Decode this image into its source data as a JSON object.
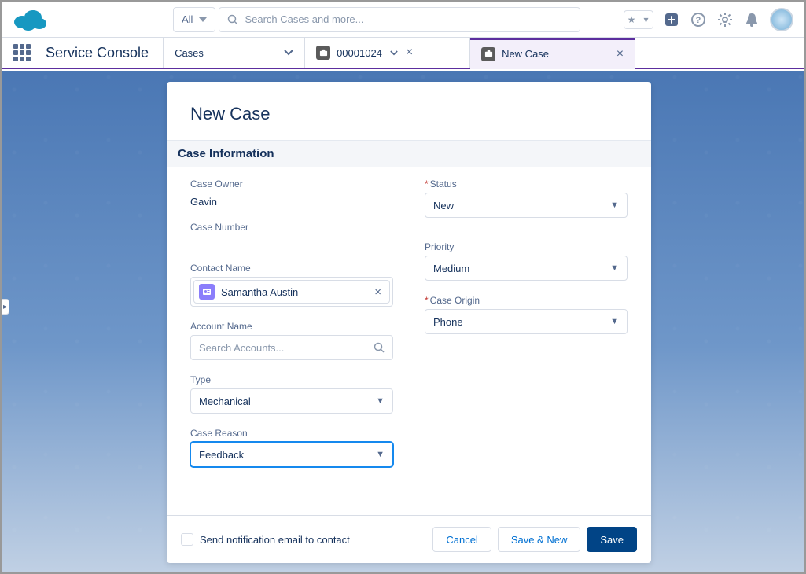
{
  "header": {
    "scope": "All",
    "search_placeholder": "Search Cases and more..."
  },
  "nav": {
    "app_name": "Service Console",
    "tabs": [
      {
        "label": "Cases"
      },
      {
        "label": "00001024"
      },
      {
        "label": "New Case"
      }
    ]
  },
  "modal": {
    "title": "New Case",
    "section": "Case Information",
    "left": {
      "case_owner_label": "Case Owner",
      "case_owner_value": "Gavin",
      "case_number_label": "Case Number",
      "case_number_value": "",
      "contact_name_label": "Contact Name",
      "contact_name_value": "Samantha Austin",
      "account_name_label": "Account Name",
      "account_search_placeholder": "Search Accounts...",
      "type_label": "Type",
      "type_value": "Mechanical",
      "case_reason_label": "Case Reason",
      "case_reason_value": "Feedback"
    },
    "right": {
      "status_label": "Status",
      "status_value": "New",
      "priority_label": "Priority",
      "priority_value": "Medium",
      "case_origin_label": "Case Origin",
      "case_origin_value": "Phone"
    },
    "footer": {
      "notify_label": "Send notification email to contact",
      "cancel": "Cancel",
      "save_new": "Save & New",
      "save": "Save"
    }
  }
}
